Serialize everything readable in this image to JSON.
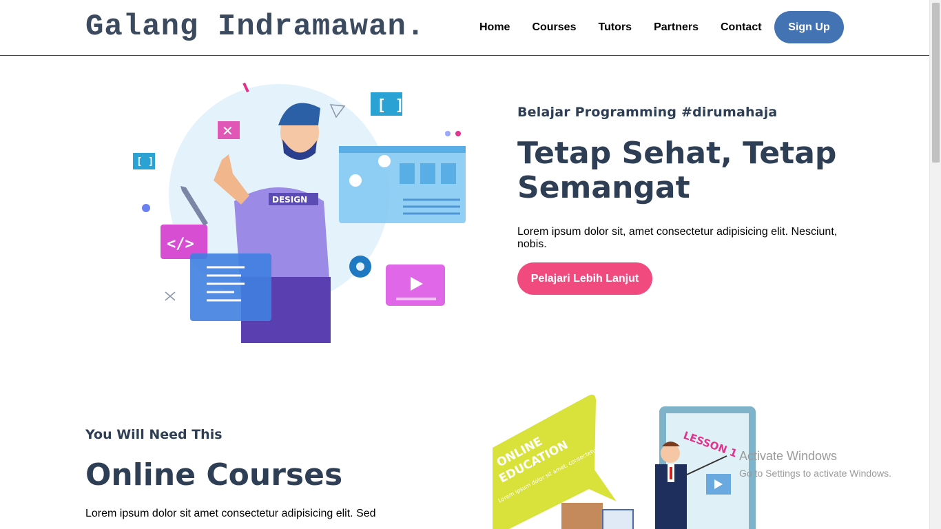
{
  "navbar": {
    "brand": "Galang Indramawan.",
    "links": [
      "Home",
      "Courses",
      "Tutors",
      "Partners",
      "Contact"
    ],
    "signup_label": "Sign Up"
  },
  "hero": {
    "eyebrow": "Belajar Programming #dirumahaja",
    "title": "Tetap Sehat, Tetap Semangat",
    "description": "Lorem ipsum dolor sit, amet consectetur adipisicing elit. Nesciunt, nobis.",
    "cta_label": "Pelajari Lebih Lanjut",
    "illustration_badge": "DESIGN"
  },
  "courses": {
    "eyebrow": "You Will Need This",
    "title": "Online Courses",
    "description": "Lorem ipsum dolor sit amet consectetur adipisicing elit. Sed",
    "illustration_heading": "ONLINE EDUCATION",
    "illustration_board": "LESSON 1",
    "illustration_small_text": "Lorem ipsum dolor sit amet, consectetur adipiscing elit, sed do eiusmod tempor incididunt ut labore et dolore magna."
  },
  "watermark": {
    "title": "Activate Windows",
    "subtitle": "Go to Settings to activate Windows."
  },
  "colors": {
    "brand_text": "#3b4a5e",
    "signup_bg": "#4473b4",
    "cta_bg": "#f14a7f",
    "heading": "#2e3e55"
  }
}
